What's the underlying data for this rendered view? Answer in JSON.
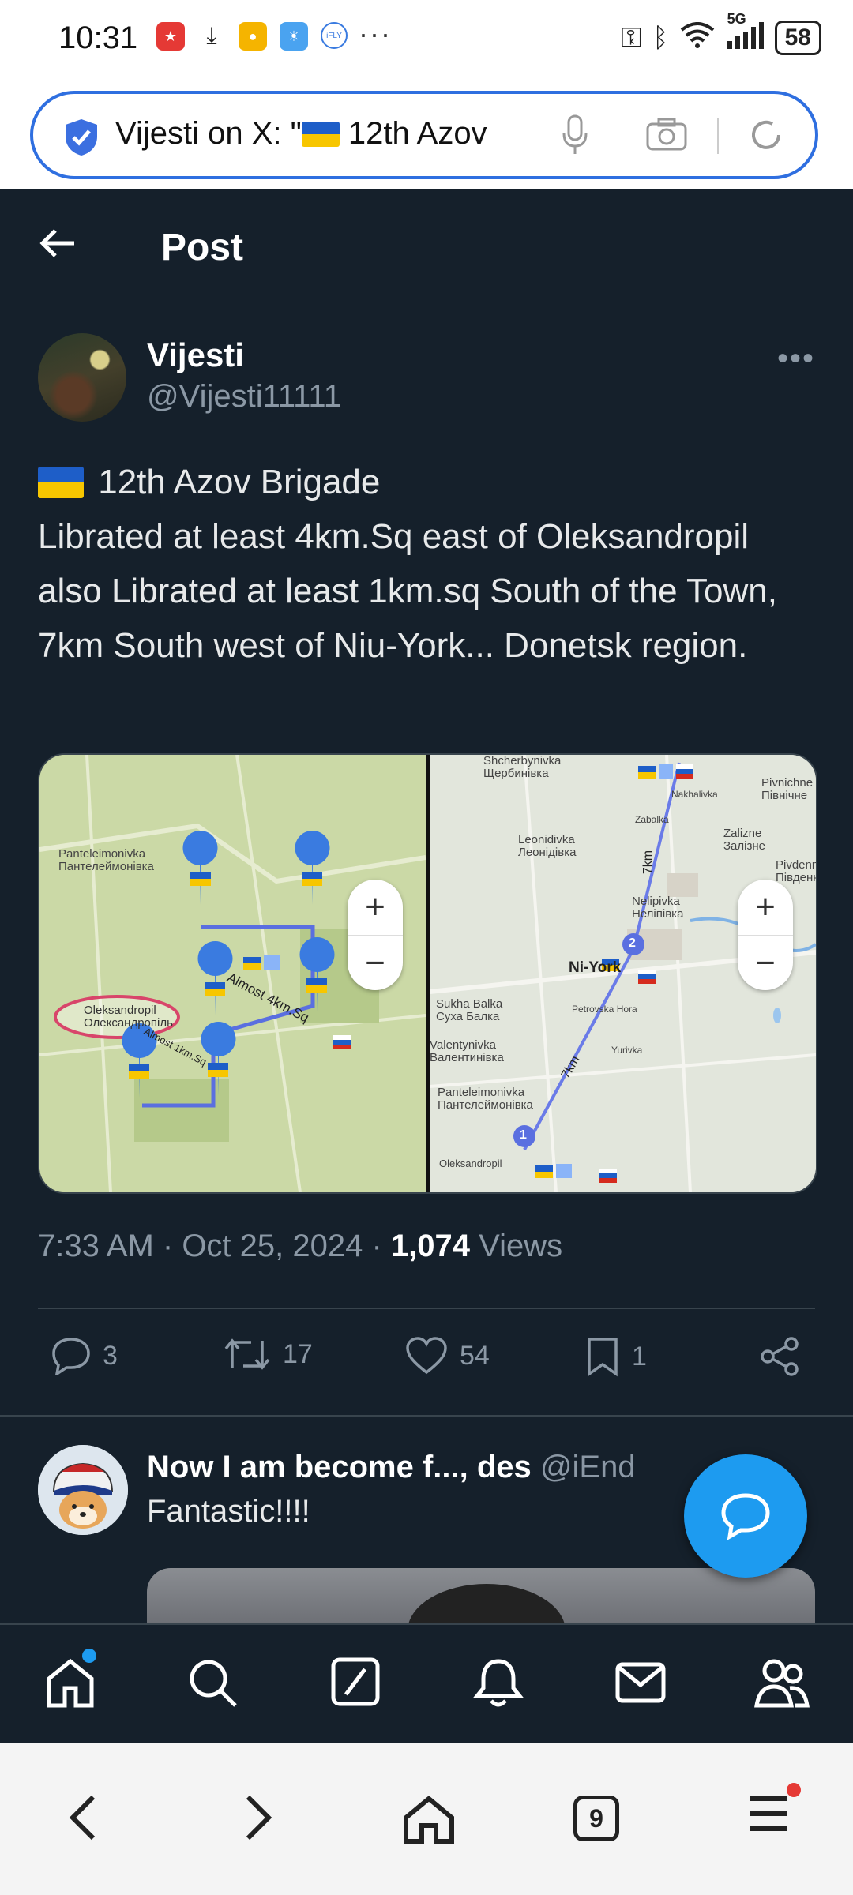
{
  "status_bar": {
    "time": "10:31",
    "more": "···",
    "network": "5G",
    "battery": "58"
  },
  "browser": {
    "url_text": "Vijesti on X: \"",
    "url_text_after_flag": " 12th Azov"
  },
  "header": {
    "title": "Post"
  },
  "post": {
    "author_name": "Vijesti",
    "author_handle": "@Vijesti11111",
    "text_line1": "12th Azov Brigade",
    "text_rest": "Librated at least 4km.Sq east of Oleksandropil also Librated at least 1km.sq South of the Town, 7km South west of Niu-York... Donetsk region.",
    "time": "7:33 AM",
    "date": "Oct 25, 2024",
    "views_count": "1,074",
    "views_label": "Views",
    "replies": "3",
    "reposts": "17",
    "likes": "54",
    "bookmarks": "1"
  },
  "map_left": {
    "labels": [
      "Panteleimonivka",
      "Пантелеймонівка",
      "Oleksandropil",
      "Олександропіль",
      "Almost 4km.Sq",
      "Almost 1km.Sq"
    ],
    "zoom_in": "+",
    "zoom_out": "−"
  },
  "map_right": {
    "labels": [
      "Shcherbynivka",
      "Щербинівка",
      "Leonidivka",
      "Леонідівка",
      "Zabalka",
      "Nakhalivka",
      "Pivnichne",
      "Північне",
      "Zalizne",
      "Залізне",
      "Pivdenne",
      "Південне",
      "Nelipivka",
      "Неліпівка",
      "Ni-York",
      "Sukha Balka",
      "Суха Балка",
      "Petrovska Hora",
      "Yurivka",
      "Valentynivka",
      "Валентинівка",
      "Panteleimonivka",
      "Пантелеймонівка",
      "Oleksandropil",
      "7km",
      "7km",
      "1",
      "2"
    ],
    "zoom_in": "+",
    "zoom_out": "−"
  },
  "reply": {
    "name": "Now I am become f..., des",
    "handle": "@iEnd",
    "text": "Fantastic!!!!"
  },
  "browser_nav": {
    "tab_count": "9"
  },
  "colors": {
    "bg": "#15202b",
    "accent": "#1d9bf0",
    "muted": "#8b98a5",
    "route": "#5a6fe0"
  }
}
